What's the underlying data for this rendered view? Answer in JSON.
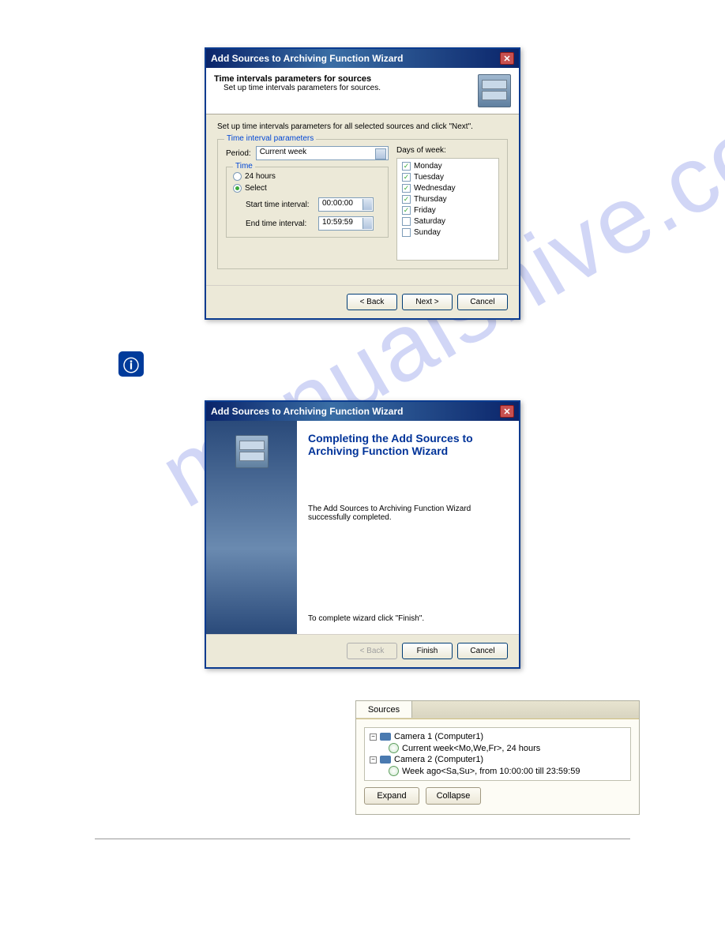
{
  "watermark": "manualshive.com",
  "dialog1": {
    "title": "Add Sources to Archiving Function Wizard",
    "header_title": "Time intervals parameters for sources",
    "header_subtitle": "Set up time intervals parameters for sources.",
    "instruction": "Set up time intervals parameters for all selected sources and click \"Next\".",
    "params_legend": "Time interval parameters",
    "period_label": "Period:",
    "period_value": "Current week",
    "time_legend": "Time",
    "radio_24h": "24 hours",
    "radio_select": "Select",
    "start_label": "Start time interval:",
    "start_value": "00:00:00",
    "end_label": "End time interval:",
    "end_value": "10:59:59",
    "days_label": "Days of week:",
    "days": [
      {
        "label": "Monday",
        "checked": true
      },
      {
        "label": "Tuesday",
        "checked": true
      },
      {
        "label": "Wednesday",
        "checked": true
      },
      {
        "label": "Thursday",
        "checked": true
      },
      {
        "label": "Friday",
        "checked": true
      },
      {
        "label": "Saturday",
        "checked": false
      },
      {
        "label": "Sunday",
        "checked": false
      }
    ],
    "btn_back": "< Back",
    "btn_next": "Next >",
    "btn_cancel": "Cancel"
  },
  "dialog2": {
    "title": "Add Sources to Archiving Function Wizard",
    "heading": "Completing the Add Sources to Archiving Function Wizard",
    "body_text": "The Add Sources to Archiving Function Wizard successfully completed.",
    "finish_text": "To complete wizard click \"Finish\".",
    "btn_back": "< Back",
    "btn_finish": "Finish",
    "btn_cancel": "Cancel"
  },
  "sources_panel": {
    "tab_label": "Sources",
    "items": [
      {
        "name": "Camera  1 (Computer1)",
        "detail": "Current week<Mo,We,Fr>, 24 hours"
      },
      {
        "name": "Camera  2 (Computer1)",
        "detail": "Week ago<Sa,Su>, from 10:00:00 till 23:59:59"
      }
    ],
    "btn_expand": "Expand",
    "btn_collapse": "Collapse"
  }
}
